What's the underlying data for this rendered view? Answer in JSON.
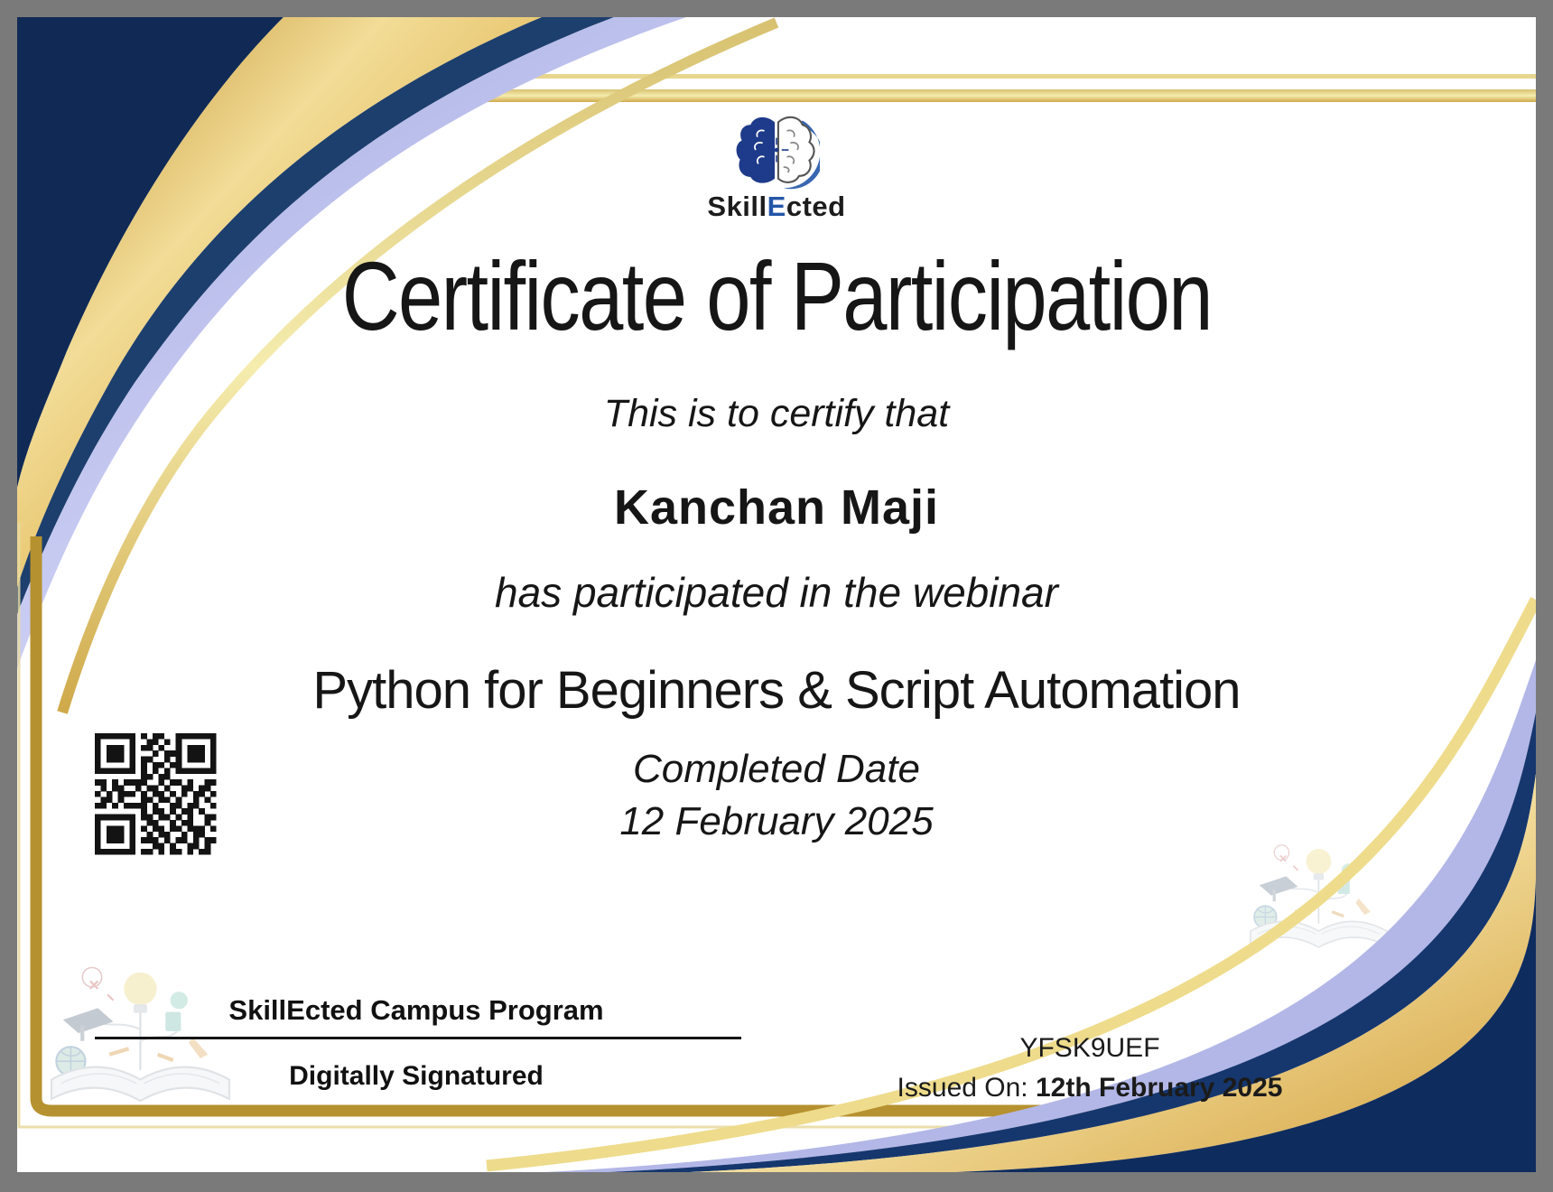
{
  "brand": {
    "prefix": "Skill",
    "accent": "E",
    "suffix": "cted"
  },
  "certificate": {
    "title": "Certificate of Participation",
    "intro": "This is to certify that",
    "recipient": "Kanchan Maji",
    "subtitle": "has participated in the webinar",
    "course": "Python for Beginners & Script Automation",
    "completed_label": "Completed Date",
    "completed_date": "12 February 2025"
  },
  "footer": {
    "issuer": "SkillEcted Campus Program",
    "signature": "Digitally Signatured",
    "code": "YFSK9UEF",
    "issued_label": "Issued On:",
    "issued_date": "12th February 2025"
  },
  "colors": {
    "frame_gray": "#7a7a7a",
    "navy": "#102a55",
    "gold": "#d9ab45",
    "lavender": "#b3b7e7",
    "accent_blue": "#2456a8"
  },
  "qr": {
    "rows": [
      "111111101011001111111",
      "100000100110101000001",
      "101110101101001011101",
      "101110100010111011101",
      "101110101100101011101",
      "100000101011011000001",
      "111111101010101111111",
      "000000001101100000000",
      "110101111001011010011",
      "010110010110100110110",
      "101011101011010101101",
      "011010001101101001010",
      "110101111010011011001",
      "000000001011010110100",
      "111111101101101010011",
      "100000100110010110010",
      "101110101011011011101",
      "101110100101100101100",
      "101110101110101101011",
      "100000100011010011010",
      "111111101101011010110"
    ]
  }
}
